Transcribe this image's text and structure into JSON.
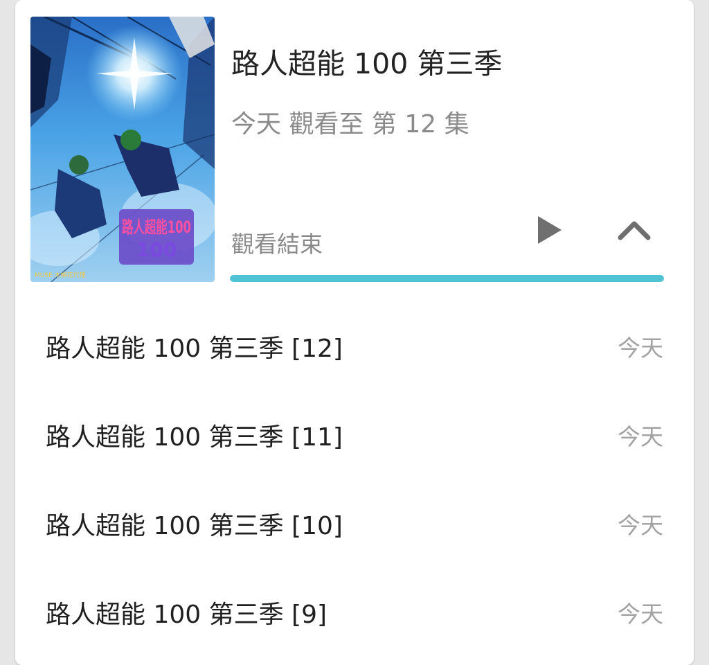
{
  "series": {
    "title": "路人超能 100 第三季",
    "watch_progress": "今天 觀看至 第 12 集",
    "status": "觀看結束",
    "progress_fraction": 1.0
  },
  "poster": {
    "logo_text": "路人超能100",
    "publisher": "MUSE 木棉花代理"
  },
  "icons": {
    "play": "play-icon",
    "collapse": "chevron-up-icon"
  },
  "colors": {
    "accent": "#4fc3d4",
    "icon": "#6f6f6f"
  },
  "episodes": [
    {
      "title": "路人超能 100 第三季 [12]",
      "date": "今天"
    },
    {
      "title": "路人超能 100 第三季 [11]",
      "date": "今天"
    },
    {
      "title": "路人超能 100 第三季 [10]",
      "date": "今天"
    },
    {
      "title": "路人超能 100 第三季 [9]",
      "date": "今天"
    }
  ]
}
